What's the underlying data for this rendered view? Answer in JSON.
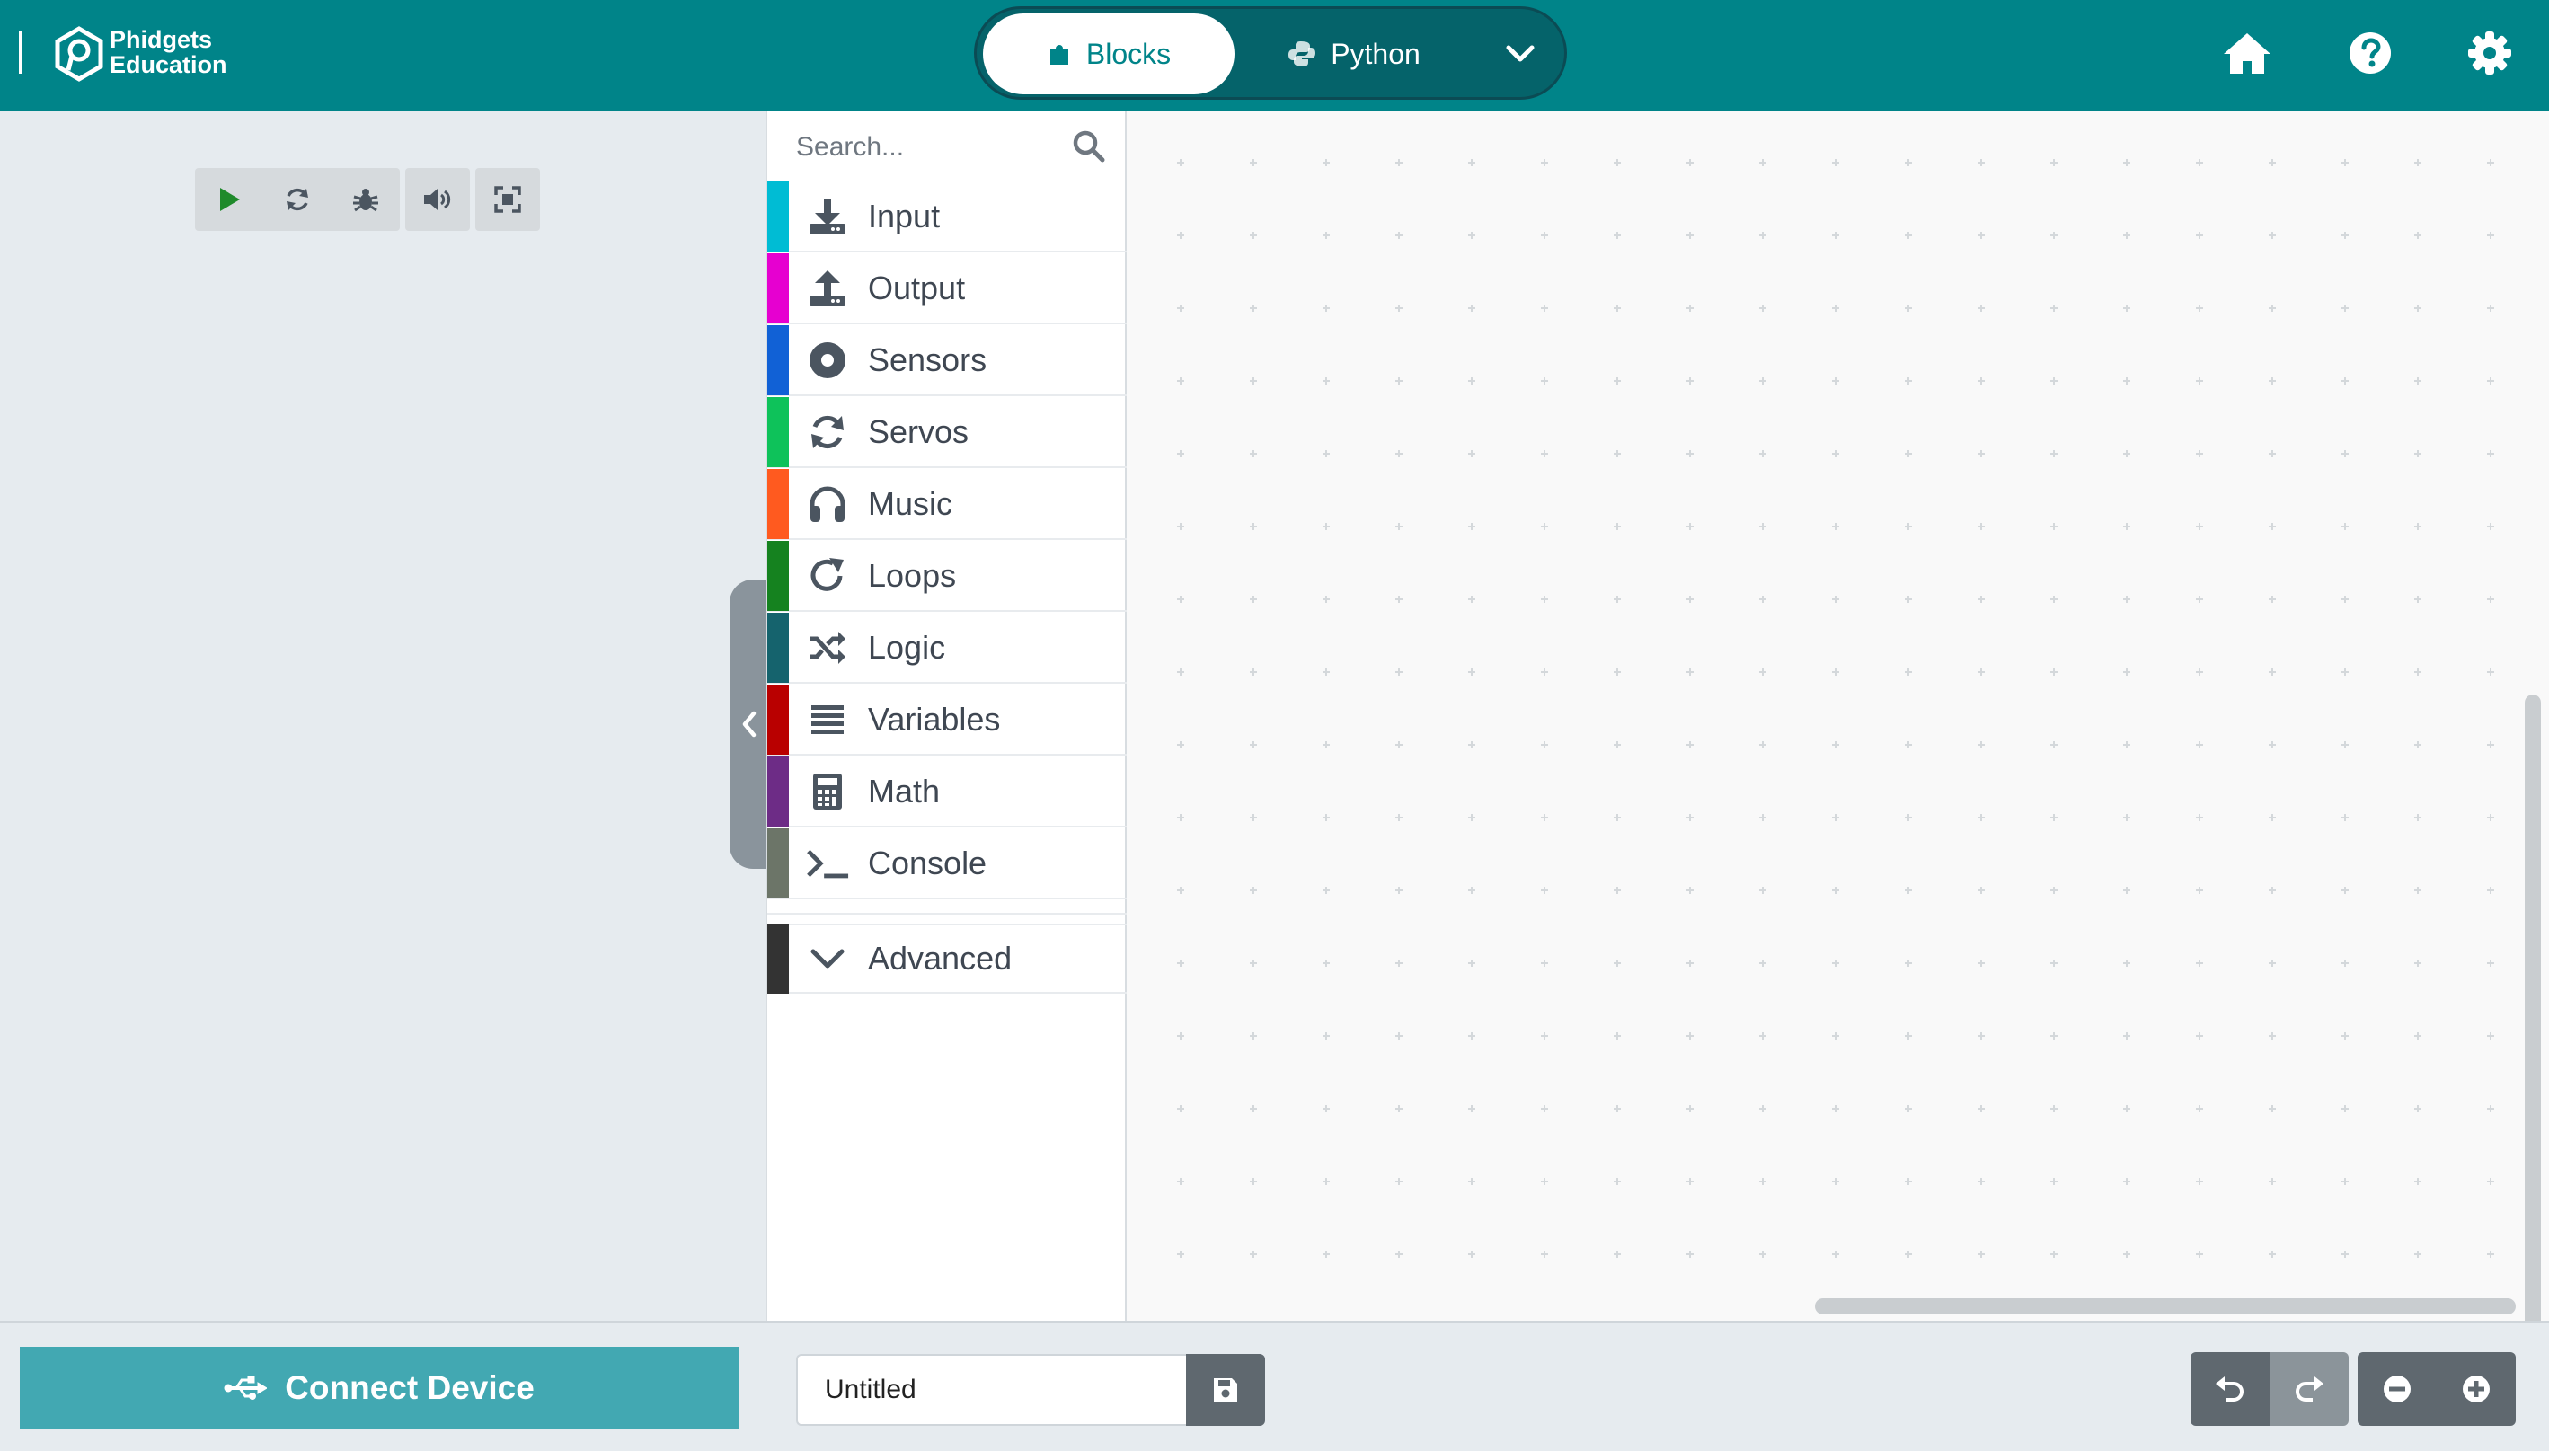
{
  "colors": {
    "header": "#008489",
    "accent": "#42a8b2",
    "workspace": "#f9f9f9"
  },
  "header": {
    "logo_line1": "Phidgets",
    "logo_line2": "Education",
    "modes": [
      {
        "label": "Blocks",
        "icon": "puzzle-icon",
        "active": true
      },
      {
        "label": "Python",
        "icon": "python-icon",
        "active": false
      }
    ],
    "right_icons": [
      "home-icon",
      "help-icon",
      "gear-icon"
    ]
  },
  "toolbar": {
    "icons": [
      "play-icon",
      "refresh-icon",
      "bug-icon",
      "volume-icon",
      "fullscreen-icon"
    ]
  },
  "toolbox": {
    "search_placeholder": "Search...",
    "categories": [
      {
        "label": "Input",
        "color": "#00bcd4",
        "icon": "download-icon"
      },
      {
        "label": "Output",
        "color": "#e600d0",
        "icon": "upload-icon"
      },
      {
        "label": "Sensors",
        "color": "#1161d6",
        "icon": "sensor-icon"
      },
      {
        "label": "Servos",
        "color": "#0ec25a",
        "icon": "sync-icon"
      },
      {
        "label": "Music",
        "color": "#ff5a1f",
        "icon": "headphones-icon"
      },
      {
        "label": "Loops",
        "color": "#15821f",
        "icon": "loop-icon"
      },
      {
        "label": "Logic",
        "color": "#15636d",
        "icon": "shuffle-icon"
      },
      {
        "label": "Variables",
        "color": "#b90000",
        "icon": "list-icon"
      },
      {
        "label": "Math",
        "color": "#6d2c86",
        "icon": "calculator-icon"
      },
      {
        "label": "Console",
        "color": "#6c7568",
        "icon": "terminal-icon"
      }
    ],
    "advanced": {
      "label": "Advanced",
      "color": "#333333",
      "icon": "chevron-down-icon"
    }
  },
  "footer": {
    "connect_label": "Connect Device",
    "project_name": "Untitled"
  }
}
